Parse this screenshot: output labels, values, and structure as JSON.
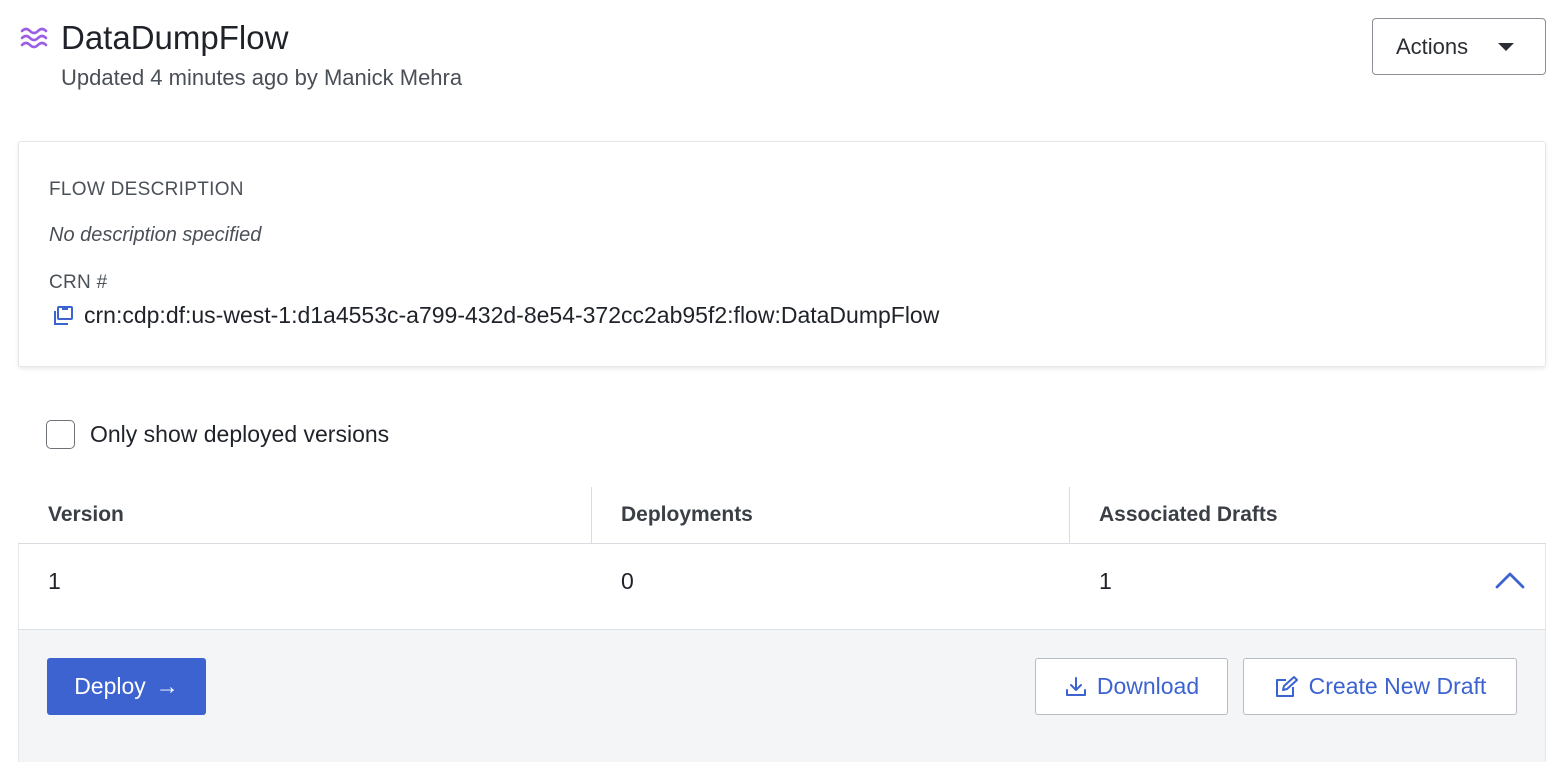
{
  "header": {
    "title": "DataDumpFlow",
    "updated": "Updated 4 minutes ago by Manick Mehra",
    "actions_label": "Actions"
  },
  "card": {
    "description_label": "FLOW DESCRIPTION",
    "description_value": "No description specified",
    "crn_label": "CRN #",
    "crn_value": "crn:cdp:df:us-west-1:d1a4553c-a799-432d-8e54-372cc2ab95f2:flow:DataDumpFlow"
  },
  "filter": {
    "only_deployed_label": "Only show deployed versions",
    "only_deployed_checked": false
  },
  "table": {
    "columns": [
      "Version",
      "Deployments",
      "Associated Drafts"
    ],
    "rows": [
      {
        "version": "1",
        "deployments": "0",
        "associated_drafts": "1",
        "expanded": true
      }
    ]
  },
  "row_actions": {
    "deploy_label": "Deploy",
    "download_label": "Download",
    "create_draft_label": "Create New Draft"
  },
  "colors": {
    "accent": "#3d63d1",
    "flow_icon": "#9b5de5"
  }
}
